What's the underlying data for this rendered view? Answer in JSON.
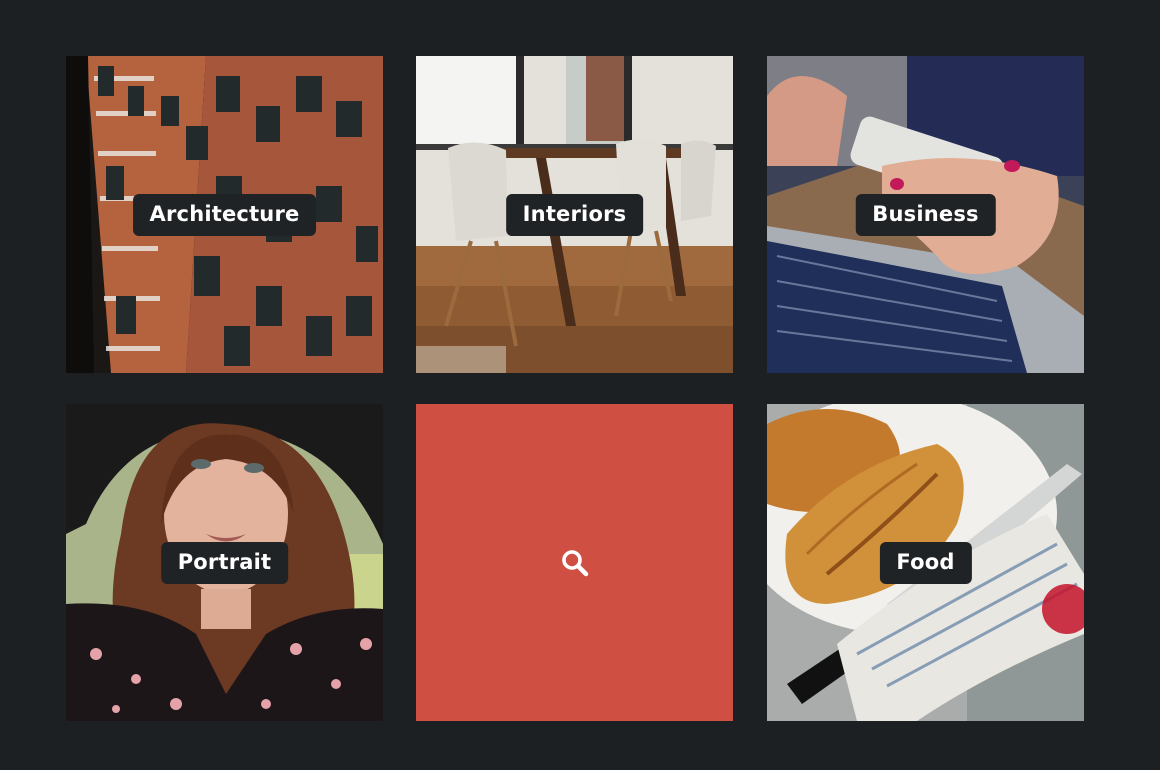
{
  "gallery": {
    "tiles": [
      {
        "label": "Architecture"
      },
      {
        "label": "Interiors"
      },
      {
        "label": "Business"
      },
      {
        "label": "Portrait"
      },
      {
        "label": "",
        "state": "hover",
        "icon": "search-icon"
      },
      {
        "label": "Food"
      }
    ]
  },
  "colors": {
    "background": "#1d2023",
    "label_bg": "#202326",
    "hover_overlay": "#cf4f43"
  }
}
